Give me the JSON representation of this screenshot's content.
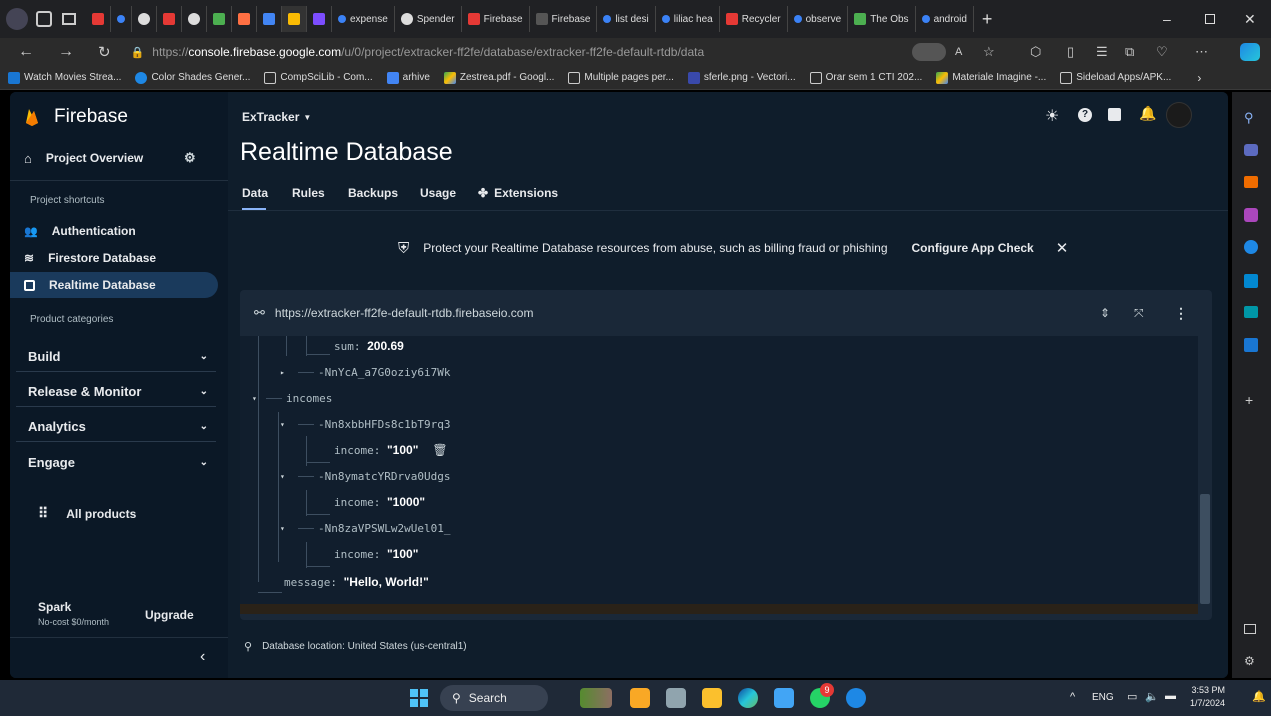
{
  "browser": {
    "tabs": [
      "expense",
      "Spender",
      "Firebase",
      "Firebase",
      "list desi",
      "liliac hea",
      "Recycler",
      "observe",
      "The Obs",
      "android"
    ],
    "url_prefix": "https://",
    "url_domain": "console.firebase.google.com",
    "url_path": "/u/0/project/extracker-ff2fe/database/extracker-ff2fe-default-rtdb/data",
    "bookmarks": [
      "Watch Movies Strea...",
      "Color Shades Gener...",
      "CompSciLib - Com...",
      "arhive",
      "Zestrea.pdf - Googl...",
      "Multiple pages per...",
      "sferle.png - Vectori...",
      "Orar sem 1 CTI 202...",
      "Materiale Imagine -...",
      "Sideload Apps/APK..."
    ]
  },
  "sidebar": {
    "brand": "Firebase",
    "project_overview": "Project Overview",
    "shortcuts_label": "Project shortcuts",
    "shortcuts": [
      "Authentication",
      "Firestore Database",
      "Realtime Database"
    ],
    "categories_label": "Product categories",
    "categories": [
      "Build",
      "Release & Monitor",
      "Analytics",
      "Engage"
    ],
    "all_products": "All products",
    "plan_name": "Spark",
    "plan_desc": "No-cost $0/month",
    "upgrade": "Upgrade"
  },
  "header": {
    "project": "ExTracker",
    "title": "Realtime Database",
    "tabs": [
      "Data",
      "Rules",
      "Backups",
      "Usage",
      "Extensions"
    ]
  },
  "banner": {
    "text": "Protect your Realtime Database resources from abuse, such as billing fraud or phishing",
    "action": "Configure App Check"
  },
  "database": {
    "url": "https://extracker-ff2fe-default-rtdb.firebaseio.com",
    "rows": {
      "sum_key": "sum:",
      "sum_val": "200.69",
      "node1": "-NnYcA_a7G0oziy6i7Wk",
      "incomes": "incomes",
      "inc1": "-Nn8xbbHFDs8c1bT9rq3",
      "inc1_key": "income:",
      "inc1_val": "\"100\"",
      "inc2": "-Nn8ymatcYRDrva0Udgs",
      "inc2_key": "income:",
      "inc2_val": "\"1000\"",
      "inc3": "-Nn8zaVPSWLw2wUel01_",
      "inc3_key": "income:",
      "inc3_val": "\"100\"",
      "msg_key": "message:",
      "msg_val": "\"Hello, World!\""
    },
    "location": "Database location: United States (us-central1)"
  },
  "taskbar": {
    "search": "Search",
    "lang": "ENG",
    "time": "3:53 PM",
    "date": "1/7/2024",
    "badge": "9"
  },
  "colors": {
    "accent": "#fbbc04",
    "link": "#8ab4f8",
    "sidebar_active": "#1a3a5c"
  }
}
